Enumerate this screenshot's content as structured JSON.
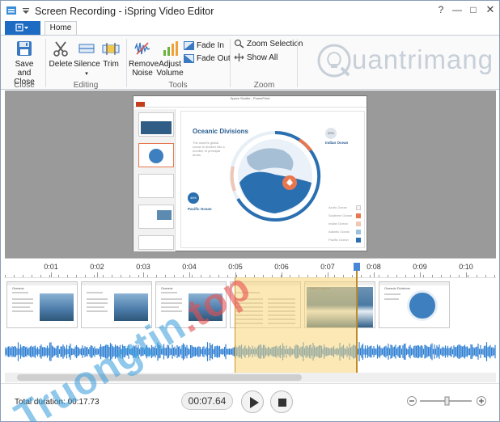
{
  "window": {
    "title": "Screen Recording - iSpring Video Editor"
  },
  "tabs": {
    "home": "Home"
  },
  "ribbon": {
    "save_close": "Save and Close",
    "save_close_l1": "Save and",
    "save_close_l2": "Close",
    "close_group": "Close",
    "delete": "Delete",
    "silence": "Silence",
    "trim": "Trim",
    "editing_group": "Editing",
    "remove_noise_l1": "Remove",
    "remove_noise_l2": "Noise",
    "adjust_volume_l1": "Adjust",
    "adjust_volume_l2": "Volume",
    "fade_in": "Fade In",
    "fade_out": "Fade Out",
    "tools_group": "Tools",
    "zoom_selection": "Zoom Selection",
    "show_all": "Show All",
    "zoom_group": "Zoom"
  },
  "watermark_logo": "uantrimang",
  "slide": {
    "app_title": "Space Shuttle - PowerPoint",
    "heading": "Oceanic Divisions",
    "indian_ocean": "Indian Ocean",
    "pacific_ocean": "Pacific Ocean",
    "pacific_pct": "46%",
    "indian_pct": "20%",
    "legend": [
      "Arctic Ocean",
      "Southern Ocean",
      "Indian Ocean",
      "Atlantic Ocean",
      "Pacific Ocean"
    ],
    "legend_colors": [
      "#ffffff",
      "#e8774f",
      "#f0c6b4",
      "#9cc1de",
      "#2a6fb0"
    ]
  },
  "timeline": {
    "ticks": [
      "0:01",
      "0:02",
      "0:03",
      "0:04",
      "0:05",
      "0:06",
      "0:07",
      "0:08",
      "0:09",
      "0:10"
    ],
    "frame_titles": [
      "Oceanic",
      "",
      "Oceanic",
      "",
      "Earth Oceans",
      "Oceanic Divisions",
      "Oceanic Area",
      "Oceanic Area",
      "Ocean"
    ]
  },
  "bottom": {
    "total_duration_label": "Total duration: 00:17.73",
    "current_time": "00:07.64"
  },
  "overlay_watermark": {
    "brand": "Truongtin",
    "tld": ".top"
  }
}
